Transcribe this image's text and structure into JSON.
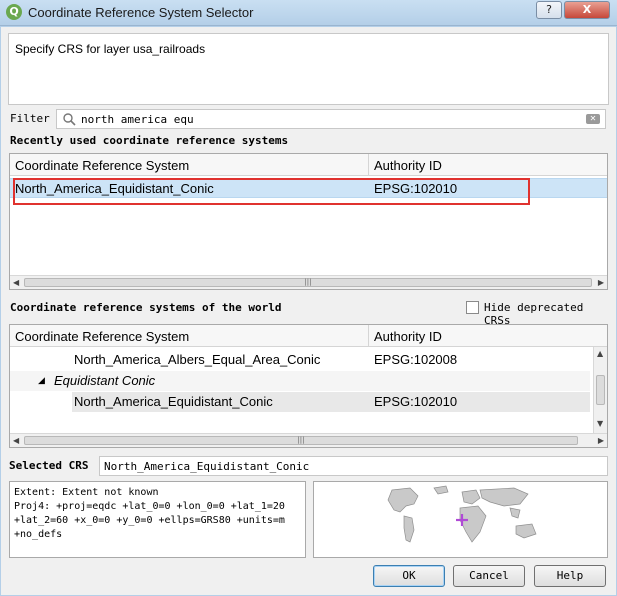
{
  "window": {
    "title": "Coordinate Reference System Selector",
    "help_glyph": "?",
    "close_glyph": "X"
  },
  "description": "Specify CRS for layer usa_railroads",
  "filter": {
    "label": "Filter",
    "value": "north america equ"
  },
  "recent": {
    "title": "Recently used coordinate reference systems",
    "headers": [
      "Coordinate Reference System",
      "Authority ID"
    ],
    "rows": [
      {
        "name": "North_America_Equidistant_Conic",
        "id": "EPSG:102010"
      }
    ]
  },
  "world": {
    "title": "Coordinate reference systems of the world",
    "hide_deprecated_label": "Hide deprecated CRSs",
    "hide_deprecated_checked": false,
    "headers": [
      "Coordinate Reference System",
      "Authority ID"
    ],
    "rows": [
      {
        "name": "North_America_Albers_Equal_Area_Conic",
        "id": "EPSG:102008"
      },
      {
        "group": "Equidistant Conic"
      },
      {
        "name": "North_America_Equidistant_Conic",
        "id": "EPSG:102010"
      }
    ]
  },
  "selected": {
    "label": "Selected CRS",
    "value": "North_America_Equidistant_Conic"
  },
  "details": {
    "line1": "Extent: Extent not known",
    "line2": "Proj4: +proj=eqdc +lat_0=0 +lon_0=0 +lat_1=20",
    "line3": "+lat_2=60 +x_0=0 +y_0=0 +ellps=GRS80 +units=m",
    "line4": "+no_defs"
  },
  "buttons": {
    "ok": "OK",
    "cancel": "Cancel",
    "help": "Help"
  },
  "colors": {
    "selection": "#cde4f7",
    "highlight_box": "#e0322f",
    "map_marker": "#b04ad6"
  }
}
